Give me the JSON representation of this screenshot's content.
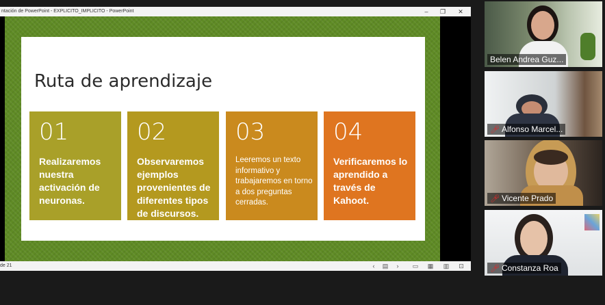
{
  "window": {
    "title": "ntación de PowerPoint  -  EXPLICITO_IMPLICITO  -  PowerPoint",
    "minimize": "–",
    "restore": "❐",
    "close": "✕"
  },
  "slide": {
    "title": "Ruta de aprendizaje",
    "boxes": [
      {
        "num": "01",
        "text": "Realizaremos nuestra activación de neuronas.",
        "color": "#a9a029"
      },
      {
        "num": "02",
        "text": "Observaremos ejemplos provenientes de diferentes tipos de discursos.",
        "color": "#b4991f"
      },
      {
        "num": "03",
        "text": "Leeremos un texto informativo y trabajaremos en torno a dos preguntas cerradas.",
        "color": "#ca8a1e"
      },
      {
        "num": "04",
        "text": "Verificaremos lo aprendido a través de Kahoot.",
        "color": "#df7520"
      }
    ],
    "background_color": "#5f8b25"
  },
  "status": {
    "page": "de 21"
  },
  "participants": [
    {
      "name": "Belen Andrea Guz...",
      "muted": false,
      "active": true
    },
    {
      "name": "Alfonso Marcel...",
      "muted": true,
      "active": false
    },
    {
      "name": "Vicente Prado",
      "muted": true,
      "active": false
    },
    {
      "name": "Constanza Roa",
      "muted": true,
      "active": false
    }
  ],
  "icons": {
    "muted": "mic-muted-icon"
  },
  "colors": {
    "active_speaker": "#b4d639",
    "muted": "#e02828"
  }
}
